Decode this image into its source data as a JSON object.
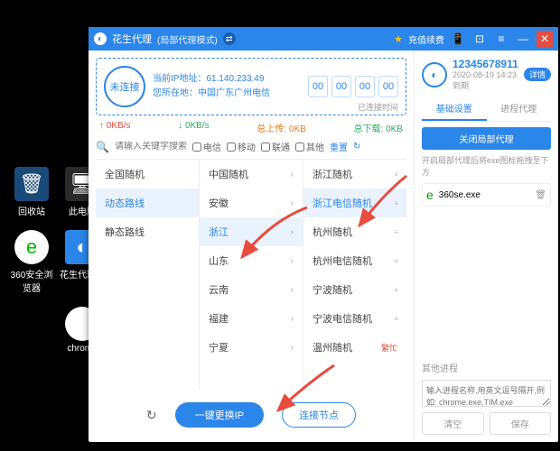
{
  "desktop": {
    "recycle": "回收站",
    "pc": "此电脑",
    "browser360": "360安全浏览器",
    "peanut": "花生代理器",
    "chrome": "chrome"
  },
  "titlebar": {
    "app_name": "花生代理",
    "mode": "(局部代理模式)",
    "recharge": "充值续费"
  },
  "status": {
    "state": "未连接",
    "ip_label": "当前IP地址：",
    "ip": "61.140.233.49",
    "loc_label": "您所在地：",
    "loc": "中国广东广州电信",
    "counters": [
      "00",
      "00",
      "00",
      "00"
    ],
    "already": "已连接时间"
  },
  "stats": {
    "up": "↑ 0KB/s",
    "down": "↓ 0KB/s",
    "total_up_label": "总上传:",
    "total_up": "0KB",
    "total_dn_label": "总下载:",
    "total_dn": "0KB"
  },
  "search": {
    "placeholder": "请输入关键字搜索节点",
    "cb_dianxin": "电信",
    "cb_yidong": "移动",
    "cb_liantong": "联通",
    "cb_other": "其他",
    "reset": "重置"
  },
  "col1": [
    "全国随机",
    "动态路线",
    "静态路线"
  ],
  "col2": [
    "中国随机",
    "安徽",
    "浙江",
    "山东",
    "云南",
    "福建",
    "宁夏"
  ],
  "col3": [
    {
      "label": "浙江随机",
      "tag": ""
    },
    {
      "label": "浙江电信随机",
      "tag": ""
    },
    {
      "label": "杭州随机",
      "tag": ""
    },
    {
      "label": "杭州电信随机",
      "tag": ""
    },
    {
      "label": "宁波随机",
      "tag": ""
    },
    {
      "label": "宁波电信随机",
      "tag": ""
    },
    {
      "label": "温州随机",
      "tag": "繁忙"
    }
  ],
  "col1_sel": 1,
  "col2_sel": 2,
  "col3_sel": 1,
  "buttons": {
    "change_ip": "一键更换IP",
    "link_node": "连接节点"
  },
  "user": {
    "id": "12345678911",
    "expire": "2020-08-19 14:23 到期",
    "detail": "详情"
  },
  "tabs": {
    "basic": "基础设置",
    "process": "进程代理"
  },
  "right": {
    "close_local": "关闭局部代理",
    "hint": "开启局部代理后将exe图标拖拽至下方",
    "proc1": "360se.exe",
    "other": "其他进程",
    "input_ph": "输入进程名称,用英文逗号隔开,例如: chrome.exe,TIM.exe",
    "clear": "清空",
    "save": "保存"
  }
}
